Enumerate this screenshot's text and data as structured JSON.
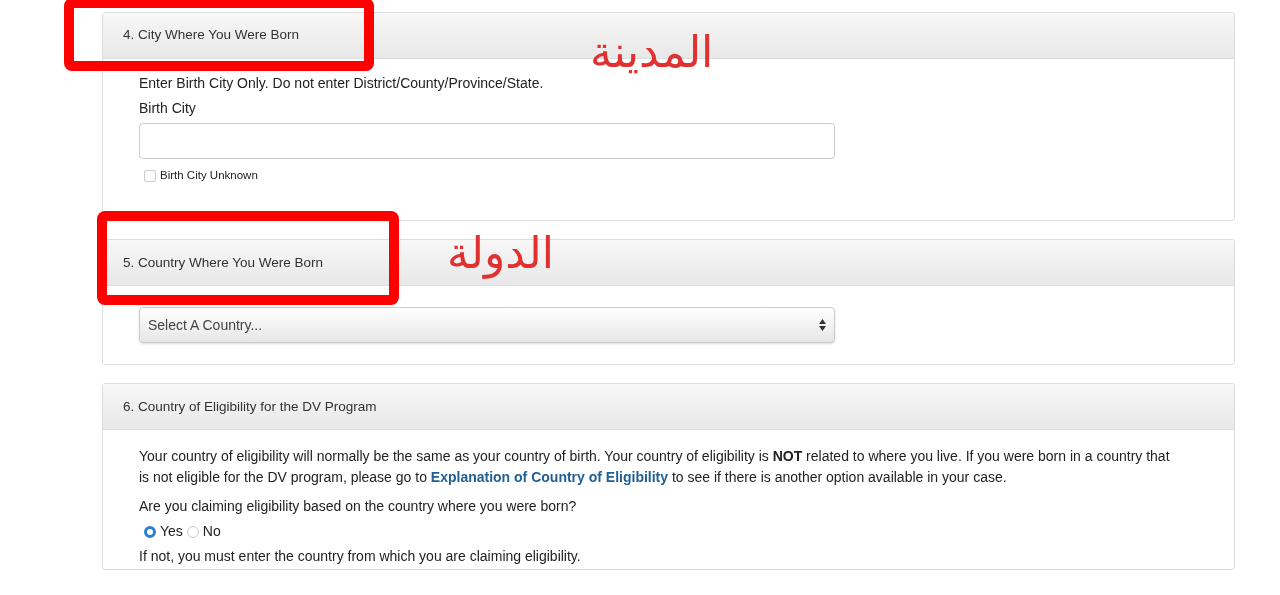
{
  "sections": [
    {
      "kind": "city",
      "title": "4. City Where You Were Born",
      "instruction": "Enter Birth City Only. Do not enter District/County/Province/State.",
      "field_label": "Birth City",
      "unknown": {
        "label": "Birth City Unknown",
        "checked": false
      }
    },
    {
      "kind": "country",
      "title": "5. Country Where You Were Born",
      "select": {
        "placeholder": "Select A Country..."
      }
    },
    {
      "kind": "eligibility",
      "title": "6. Country of Eligibility for the DV Program",
      "text_before": "Your country of eligibility will normally be the same as your country of birth. Your country of eligibility is **NOT** related to where you live. If you were born in a country that is not eligible for the DV program, please go to ",
      "link": "Explanation of Country of Eligibility",
      "text_after": " to see if there is another option available in your case.",
      "question": "Are you claiming eligibility based on the country where you were born?",
      "options": [
        {
          "label": "Yes",
          "selected": true
        },
        {
          "label": "No",
          "selected": false
        }
      ],
      "note": "If not, you must enter the country from which you are claiming eligibility."
    }
  ],
  "annotations": [
    {
      "text": "المدينة"
    },
    {
      "text": "الدولة"
    }
  ]
}
